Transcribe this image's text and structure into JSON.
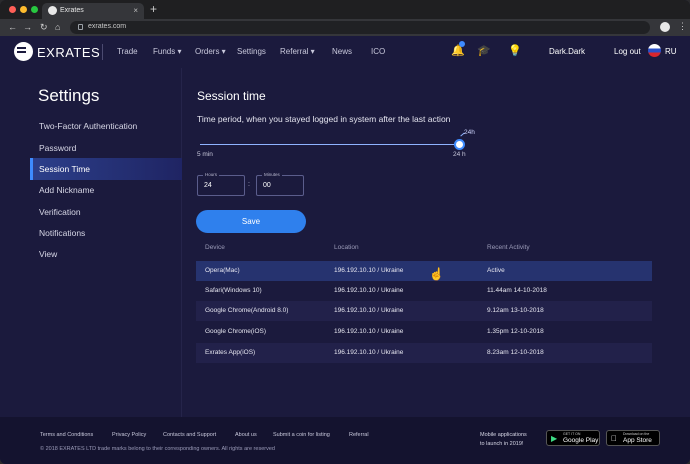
{
  "browser": {
    "tab_title": "Exrates",
    "url": "exrates.com",
    "new_tab_symbol": "+",
    "close_symbol": "×",
    "menu_symbol": "⋮"
  },
  "header": {
    "logo_text": "EXRATES",
    "nav": [
      "Trade",
      "Funds ▾",
      "Orders ▾",
      "Settings",
      "Referral ▾",
      "News",
      "ICO"
    ],
    "notification_count": "1",
    "username": "Dark.Dark",
    "logout_label": "Log out",
    "language": "RU"
  },
  "sidebar": {
    "title": "Settings",
    "items": [
      {
        "label": "Two-Factor Authentication"
      },
      {
        "label": "Password"
      },
      {
        "label": "Session Time"
      },
      {
        "label": "Add Nickname"
      },
      {
        "label": "Verification"
      },
      {
        "label": "Notifications"
      },
      {
        "label": "View"
      }
    ]
  },
  "session": {
    "title": "Session time",
    "description": "Time period, when you stayed logged in system after the last action",
    "slider_min": "5 min",
    "slider_max": "24 h",
    "slider_value": "24h",
    "hours_label": "Hours",
    "hours_value": "24",
    "minutes_label": "Minutes",
    "minutes_value": "00",
    "separator": ":",
    "save_label": "Save"
  },
  "table": {
    "headers": [
      "Device",
      "Location",
      "Recent Activity"
    ],
    "rows": [
      [
        "Opera(Mac)",
        "196.192.10.10 / Ukraine",
        "Active"
      ],
      [
        "Safari(Windows 10)",
        "196.192.10.10 / Ukraine",
        "11.44am 14-10-2018"
      ],
      [
        "Google Chrome(Android 8.0)",
        "196.192.10.10 / Ukraine",
        "9.12am 13-10-2018"
      ],
      [
        "Google Chrome(iOS)",
        "196.192.10.10 / Ukraine",
        "1.35pm 12-10-2018"
      ],
      [
        "Exrates App(iOS)",
        "196.192.10.10 / Ukraine",
        "8.23am 12-10-2018"
      ]
    ]
  },
  "footer": {
    "links": [
      "Terms and Conditions",
      "Privacy Policy",
      "Contacts and Support",
      "About us",
      "Submit a coin for listing",
      "Referral"
    ],
    "copyright": "© 2018 EXRATES LTD trade marks belong to their corresponding owners. All rights are reserved",
    "mobile_line1": "Mobile applications",
    "mobile_line2": "to launch in 2019!",
    "google_small": "GET IT ON",
    "google_big": "Google Play",
    "apple_small": "Download on the",
    "apple_big": "App Store"
  },
  "colors": {
    "background": "#1b1a3d",
    "accent": "#2f80ed",
    "selected_row": "#26336f"
  }
}
